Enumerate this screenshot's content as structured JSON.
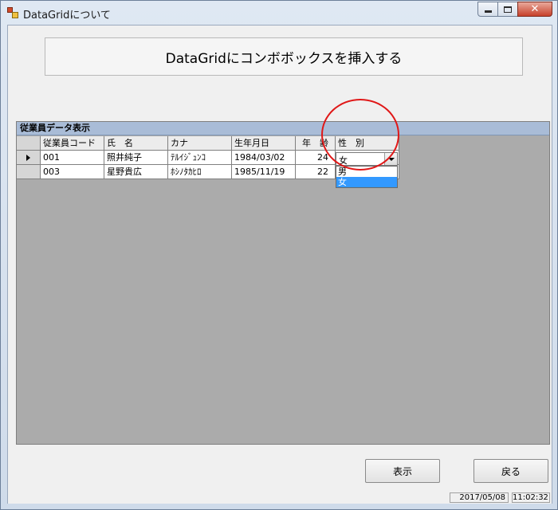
{
  "window": {
    "title": "DataGridについて"
  },
  "header": {
    "title": "DataGridにコンボボックスを挿入する"
  },
  "grid": {
    "caption": "従業員データ表示",
    "columns": [
      "従業員コード",
      "氏　名",
      "カナ",
      "生年月日",
      "年　齢",
      "性　別"
    ],
    "rows": [
      {
        "code": "001",
        "name": "照井純子",
        "kana": "ﾃﾙｲｼﾞｭﾝｺ",
        "birth": "1984/03/02",
        "age": "24",
        "sex": "女"
      },
      {
        "code": "003",
        "name": "星野貴広",
        "kana": "ﾎｼﾉﾀｶﾋﾛ",
        "birth": "1985/11/19",
        "age": "22",
        "sex": ""
      }
    ],
    "combo": {
      "value": "女",
      "options": [
        "男",
        "女"
      ],
      "selected_index": 1
    }
  },
  "buttons": {
    "show": "表示",
    "back": "戻る"
  },
  "statusbar": {
    "date": "2017/05/08",
    "time": "11:02:32"
  },
  "colors": {
    "grid_bg": "#ababab",
    "caption_bg": "#a9bcd7",
    "highlight": "#3399ff",
    "annotation": "#e01818"
  }
}
